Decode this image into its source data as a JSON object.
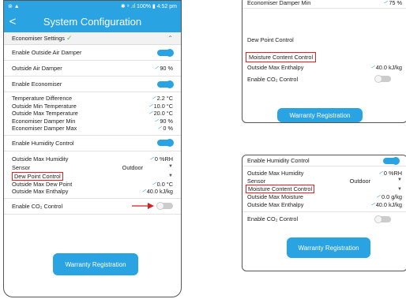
{
  "status_bar": {
    "left": "⊚ ▲",
    "right": "✱ ⁹ .ıl 100% ▮ 4:52 pm"
  },
  "app_bar": {
    "title": "System Configuration",
    "back": "<"
  },
  "section": {
    "label": "Economiser Settings"
  },
  "rows": {
    "enable_outside_air_damper": "Enable Outside Air Damper",
    "outside_air_damper": "Outside Air Damper",
    "outside_air_damper_val": "90 %",
    "enable_economiser": "Enable Economiser",
    "temp_diff": "Temperature Difference",
    "temp_diff_val": "2.2 °C",
    "outside_min_temp": "Outside Min Temperature",
    "outside_min_temp_val": "10.0 °C",
    "outside_max_temp": "Outside Max Temperature",
    "outside_max_temp_val": "20.0 °C",
    "econ_damper_min": "Economiser Damper Min",
    "econ_damper_min_val": "90 %",
    "econ_damper_max": "Economiser Damper Max",
    "econ_damper_max_val": "0 %",
    "enable_humidity_control": "Enable Humidity Control",
    "outside_max_humidity": "Outside Max Humidity",
    "outside_max_humidity_val": "0 %RH",
    "sensor": "Sensor",
    "sensor_val": "Outdoor",
    "dew_point_control": "Dew Point Control",
    "outside_max_dew_point": "Outside Max Dew Point",
    "outside_max_dew_point_val": "0.0 °C",
    "outside_max_enthalpy": "Outside Max Enthalpy",
    "outside_max_enthalpy_val": "40.0 kJ/kg",
    "enable_co2_control": "Enable CO₂ Control"
  },
  "warranty_button": "Warranty Registration",
  "panel_top": {
    "row_top": "Economiser Damper Min",
    "row_top_val": "75 %",
    "option_dew": "Dew Point Control",
    "option_moisture": "Moisture Content Control",
    "enthalpy": "Outside Max Enthalpy",
    "enthalpy_val": "40.0 kJ/kg",
    "co2": "Enable CO₂ Control",
    "button": "Warranty Registration"
  },
  "panel_bottom": {
    "enable_humidity": "Enable Humidity Control",
    "max_humidity": "Outside Max Humidity",
    "max_humidity_val": "0 %RH",
    "sensor": "Sensor",
    "sensor_val": "Outdoor",
    "moisture_control": "Moisture Content Control",
    "max_moisture": "Outside Max Moisture",
    "max_moisture_val": "0.0 g/kg",
    "max_enthalpy": "Outside Max Enthalpy",
    "max_enthalpy_val": "40.0 kJ/kg",
    "co2": "Enable CO₂ Control",
    "button": "Warranty Registration"
  },
  "colors": {
    "accent": "#2aa3e3",
    "highlight": "#d22222",
    "check": "#5cb85c"
  }
}
